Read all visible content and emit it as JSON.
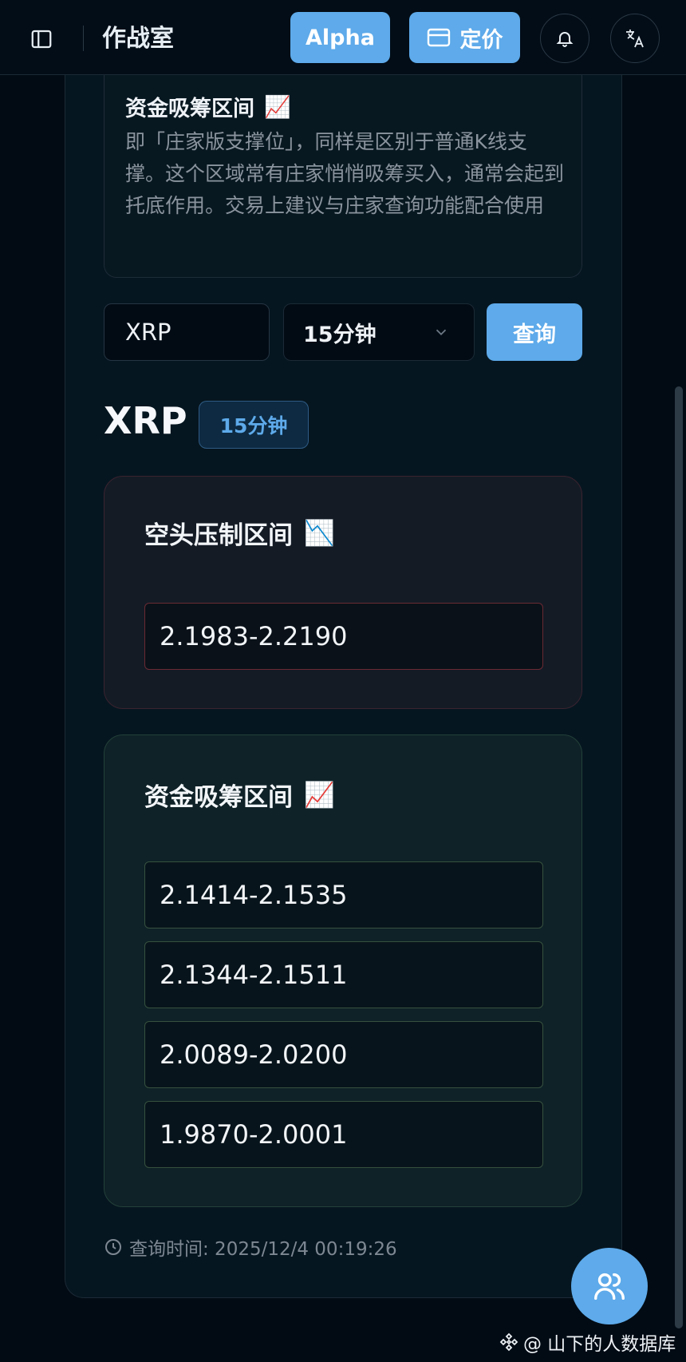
{
  "header": {
    "title": "作战室",
    "alpha_label": "Alpha",
    "pricing_label": "定价"
  },
  "info": {
    "title": "资金吸筹区间",
    "title_emoji": "📈",
    "description": "即「庄家版支撑位」，同样是区别于普通K线支撑。这个区域常有庄家悄悄吸筹买入，通常会起到托底作用。交易上建议与庄家查询功能配合使用"
  },
  "query": {
    "symbol_value": "XRP",
    "interval_value": "15分钟",
    "submit_label": "查询"
  },
  "result": {
    "symbol": "XRP",
    "interval_badge": "15分钟",
    "short_zone": {
      "title": "空头压制区间",
      "emoji": "📉",
      "ranges": [
        "2.1983-2.2190"
      ]
    },
    "accumulation_zone": {
      "title": "资金吸筹区间",
      "emoji": "📈",
      "ranges": [
        "2.1414-2.1535",
        "2.1344-2.1511",
        "2.0089-2.0200",
        "1.9870-2.0001"
      ]
    },
    "query_time": "查询时间: 2025/12/4 00:19:26"
  },
  "watermark": "@ 山下的人数据库",
  "colors": {
    "accent": "#5eaaea",
    "background": "#020b14",
    "short_border": "#6a2a34",
    "accumulation_border": "#36513f"
  },
  "icons": [
    "sidebar-toggle-icon",
    "credit-card-icon",
    "bell-icon",
    "translate-icon",
    "chevron-down-icon",
    "clock-icon",
    "users-icon",
    "binance-logo-icon"
  ]
}
